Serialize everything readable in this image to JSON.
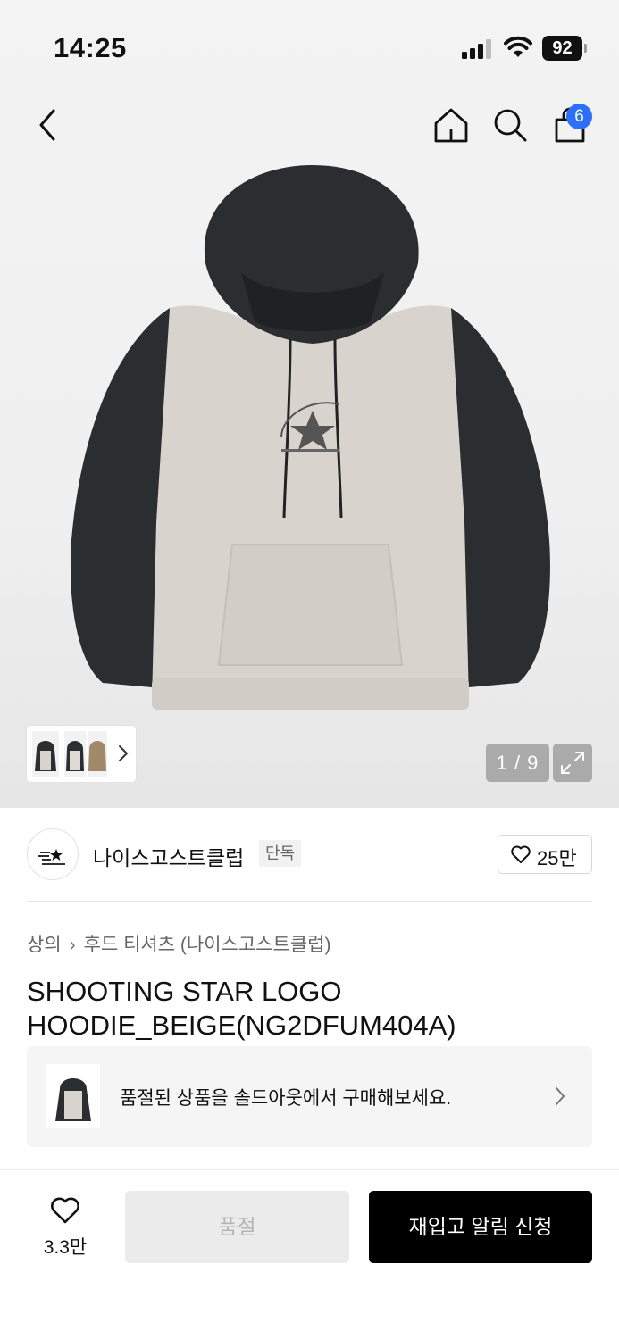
{
  "status_bar": {
    "time": "14:25",
    "battery": "92",
    "icons": [
      "cellular-signal-icon",
      "wifi-icon",
      "battery-icon"
    ]
  },
  "nav": {
    "cart_count": "6",
    "icons": [
      "back-chevron-icon",
      "home-icon",
      "search-icon",
      "shopping-bag-icon"
    ]
  },
  "gallery": {
    "counter": "1 / 9",
    "icons": [
      "expand-icon",
      "chevron-right-icon"
    ]
  },
  "brand": {
    "name": "나이스고스트클럽",
    "tag": "단독",
    "like_count": "25만"
  },
  "product": {
    "breadcrumb": [
      "상의",
      "후드 티셔츠 (나이스고스트클럽)"
    ],
    "title": "SHOOTING STAR LOGO HOODIE_BEIGE(NG2DFUM404A)"
  },
  "resale_banner": {
    "text": "품절된 상품을 솔드아웃에서 구매해보세요."
  },
  "bottom_bar": {
    "wish_count": "3.3만",
    "soldout_label": "품절",
    "restock_label": "재입고 알림 신청"
  },
  "colors": {
    "accent_badge": "#2b6fff",
    "primary_button": "#000000",
    "disabled_button": "#ebebeb"
  }
}
